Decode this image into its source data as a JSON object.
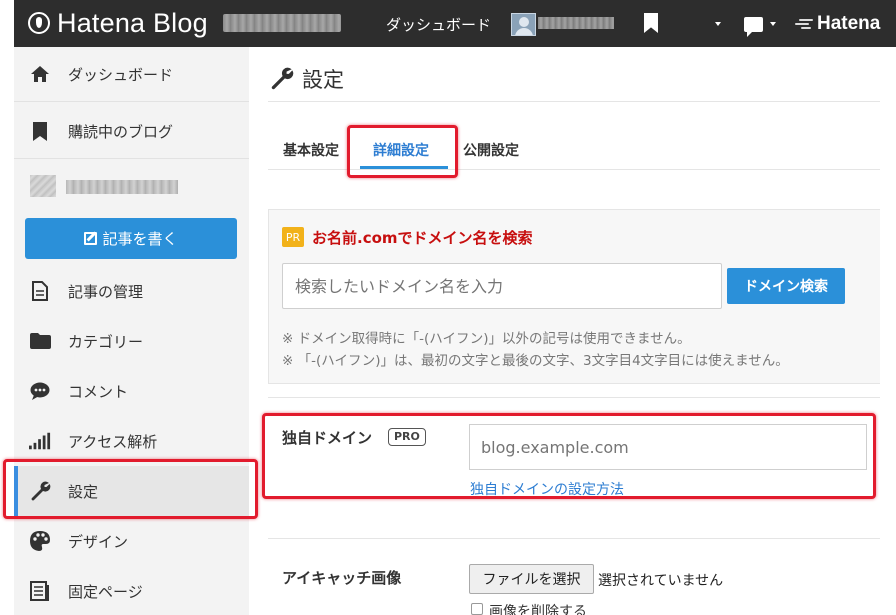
{
  "header": {
    "logo_text": "Hatena Blog",
    "dashboard_label": "ダッシュボード",
    "brand_text": "Hatena"
  },
  "sidebar": {
    "items": [
      {
        "label": "ダッシュボード",
        "icon": "home-icon"
      },
      {
        "label": "購読中のブログ",
        "icon": "bookmark-icon"
      },
      {
        "label": "記事の管理",
        "icon": "document-icon"
      },
      {
        "label": "カテゴリー",
        "icon": "folder-icon"
      },
      {
        "label": "コメント",
        "icon": "comment-icon"
      },
      {
        "label": "アクセス解析",
        "icon": "bar-chart-icon"
      },
      {
        "label": "設定",
        "icon": "wrench-icon",
        "active": true
      },
      {
        "label": "デザイン",
        "icon": "palette-icon"
      },
      {
        "label": "固定ページ",
        "icon": "pages-icon"
      }
    ],
    "write_button": "記事を書く"
  },
  "main": {
    "title": "設定",
    "tabs": [
      {
        "label": "基本設定"
      },
      {
        "label": "詳細設定",
        "active": true
      },
      {
        "label": "公開設定"
      }
    ],
    "pr": {
      "badge": "PR",
      "title": "お名前.comでドメイン名を検索",
      "input_placeholder": "検索したいドメイン名を入力",
      "button": "ドメイン検索",
      "notes": [
        "※ ドメイン取得時に「-(ハイフン)」以外の記号は使用できません。",
        "※ 「-(ハイフン)」は、最初の文字と最後の文字、3文字目4文字目には使えません。"
      ]
    },
    "custom_domain": {
      "label": "独自ドメイン",
      "badge": "PRO",
      "placeholder": "blog.example.com",
      "help_link": "独自ドメインの設定方法"
    },
    "eyecatch": {
      "label": "アイキャッチ画像",
      "file_button": "ファイルを選択",
      "file_status": "選択されていません",
      "delete_label": "画像を削除する"
    }
  },
  "colors": {
    "header_bg": "#2d2d2d",
    "accent": "#2b90d9",
    "pr_title": "#c70f0f",
    "highlight": "#e21b2d"
  }
}
